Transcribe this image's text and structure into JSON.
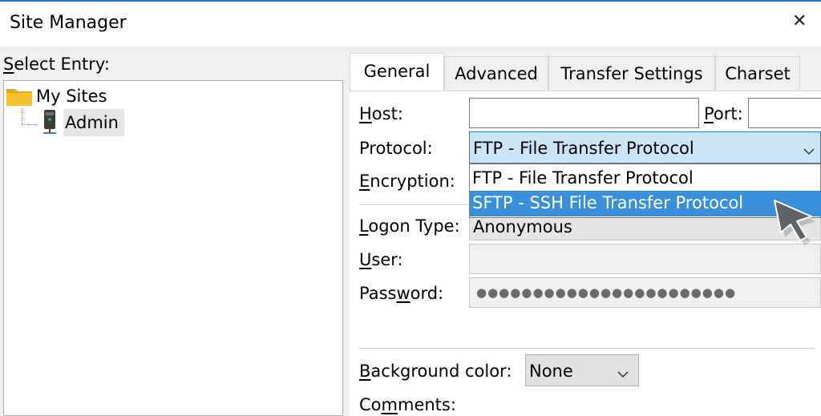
{
  "window": {
    "title": "Site Manager",
    "close_glyph": "✕"
  },
  "tree": {
    "label": "Select Entry:",
    "root": {
      "label": "My Sites",
      "icon": "folder-icon"
    },
    "child": {
      "label": "Admin",
      "icon": "server-icon"
    }
  },
  "tabs": [
    {
      "label": "General",
      "active": true
    },
    {
      "label": "Advanced"
    },
    {
      "label": "Transfer Settings"
    },
    {
      "label": "Charset"
    }
  ],
  "form": {
    "host_label": "Host:",
    "host_value": "",
    "port_label": "Port:",
    "port_value": "",
    "protocol_label": "Protocol:",
    "protocol_value": "FTP - File Transfer Protocol",
    "encryption_label": "Encryption:",
    "logon_label": "Logon Type:",
    "logon_value": "Anonymous",
    "user_label": "User:",
    "user_value": "",
    "password_label": "Password:",
    "password_value": "●●●●●●●●●●●●●●●●●●●●●●●",
    "bgcolor_label": "Background color:",
    "bgcolor_value": "None",
    "comments_label": "Comments:"
  },
  "protocol_options": [
    {
      "label": "FTP - File Transfer Protocol",
      "selected": false
    },
    {
      "label": "SFTP - SSH File Transfer Protocol",
      "selected": true
    }
  ],
  "colors": {
    "accent": "#1a78d6",
    "selection": "#3a8fdb",
    "dropdown_highlight": "#cce4f7"
  }
}
